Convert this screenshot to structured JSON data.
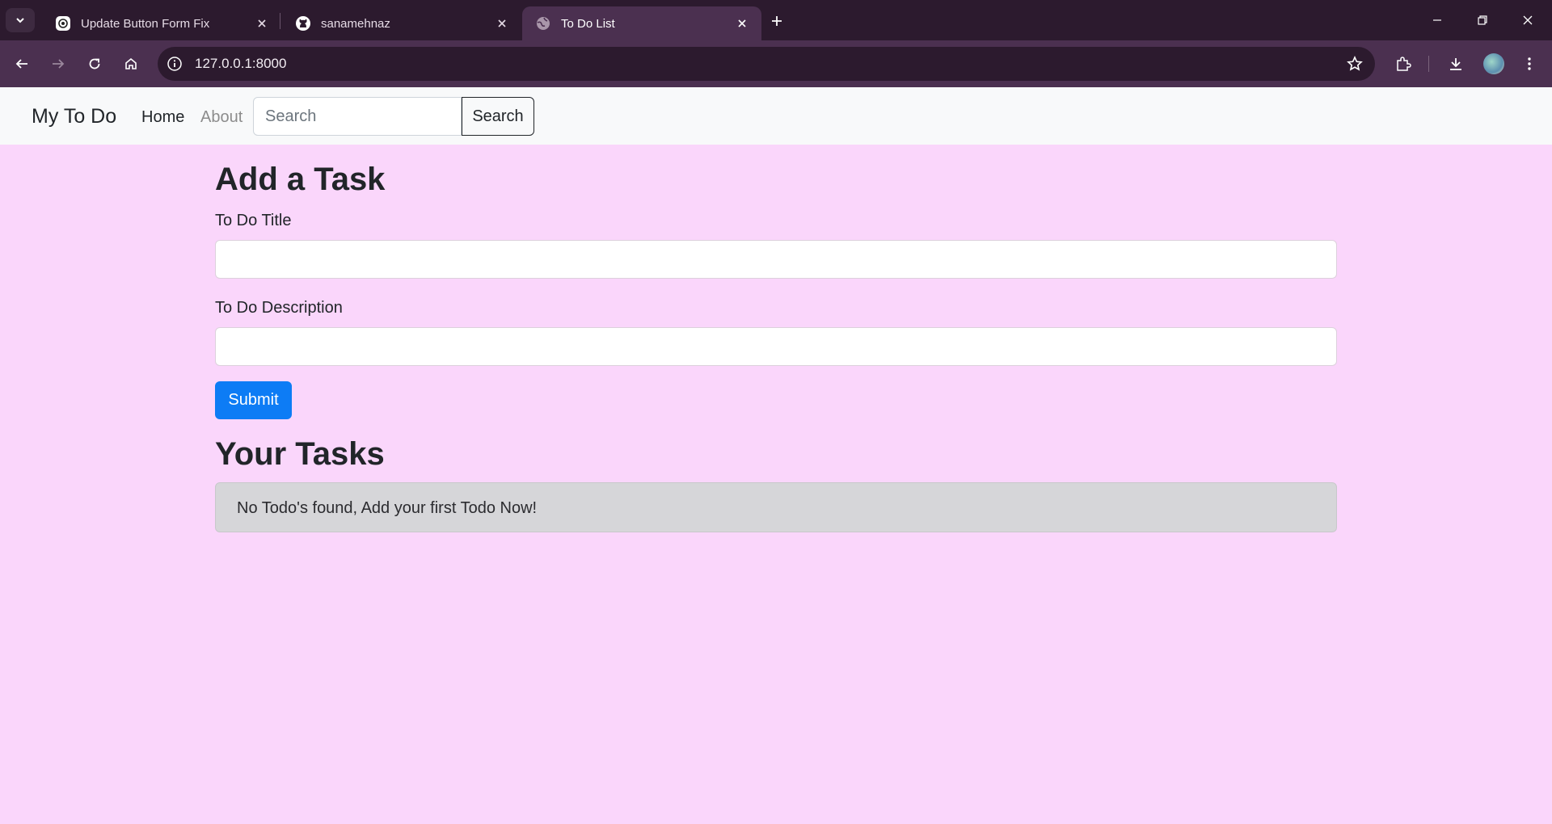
{
  "browser": {
    "tabs": [
      {
        "title": "Update Button Form Fix",
        "icon": "openai-icon",
        "active": false
      },
      {
        "title": "sanamehnaz",
        "icon": "github-icon",
        "active": false
      },
      {
        "title": "To Do List",
        "icon": "globe-icon",
        "active": true
      }
    ],
    "url": "127.0.0.1:8000"
  },
  "navbar": {
    "brand": "My To Do",
    "links": [
      "Home",
      "About"
    ],
    "search_placeholder": "Search",
    "search_button": "Search"
  },
  "form": {
    "heading": "Add a Task",
    "title_label": "To Do Title",
    "title_value": "",
    "description_label": "To Do Description",
    "description_value": "",
    "submit_label": "Submit"
  },
  "tasks": {
    "heading": "Your Tasks",
    "empty_message": "No Todo's found, Add your first Todo Now!"
  },
  "colors": {
    "page_background": "#fad6fb",
    "primary_button": "#0d7cf5",
    "browser_frame": "#2c1a2e"
  }
}
